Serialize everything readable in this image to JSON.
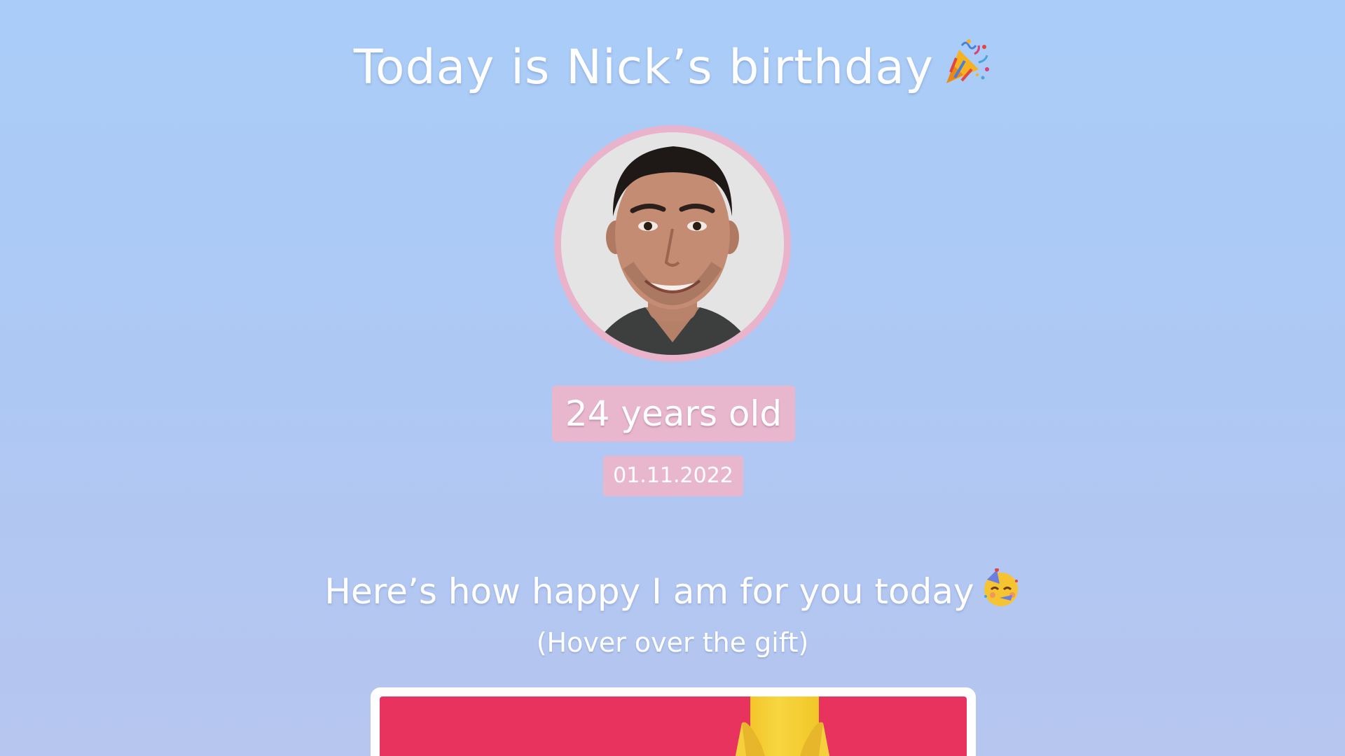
{
  "header": {
    "title": "Today is Nick’s birthday",
    "title_emoji": "party-popper-icon"
  },
  "profile": {
    "photo": "profile-photo",
    "age_label": "24 years old",
    "date": "01.11.2022"
  },
  "message": {
    "text": "Here’s how happy I am for you today",
    "emoji": "partying-face-icon",
    "hint": "(Hover over the gift)"
  },
  "gift": {
    "icon": "gift-box-icon"
  },
  "colors": {
    "background_top": "#a9cdf8",
    "background_bottom": "#b6c6ef",
    "badge": "#e8b7cd",
    "gift_box": "#e9335f",
    "ribbon": "#f3c52a",
    "text": "#ffffff"
  }
}
